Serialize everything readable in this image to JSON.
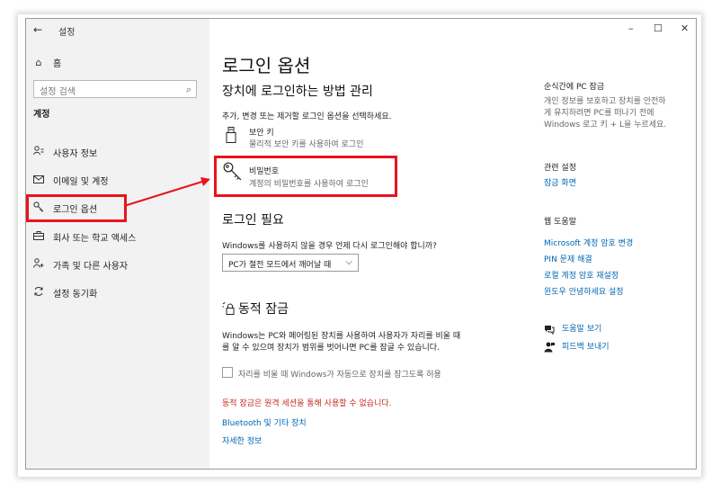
{
  "window": {
    "back_icon": "back-arrow-icon",
    "title": "설정",
    "minimize": "–",
    "maximize": "☐",
    "close": "✕"
  },
  "sidebar": {
    "home_label": "홈",
    "search_placeholder": "설정 검색",
    "section_title": "계정",
    "items": [
      {
        "label": "사용자 정보",
        "icon": "person-icon"
      },
      {
        "label": "이메일 및 계정",
        "icon": "mail-icon"
      },
      {
        "label": "로그인 옵션",
        "icon": "key-icon"
      },
      {
        "label": "회사 또는 학교 액세스",
        "icon": "briefcase-icon"
      },
      {
        "label": "가족 및 다른 사용자",
        "icon": "people-icon"
      },
      {
        "label": "설정 동기화",
        "icon": "sync-icon"
      }
    ]
  },
  "main": {
    "page_title": "로그인 옵션",
    "manage_title": "장치에 로그인하는 방법 관리",
    "manage_desc": "추가, 변경 또는 제거할 로그인 옵션을 선택하세요.",
    "options": [
      {
        "title": "보안 키",
        "desc": "물리적 보안 키를 사용하여 로그인"
      },
      {
        "title": "비밀번호",
        "desc": "계정의 비밀번호를 사용하여 로그인"
      }
    ],
    "require_title": "로그인 필요",
    "require_question": "Windows를 사용하지 않을 경우 언제 다시 로그인해야 합니까?",
    "require_value": "PC가 절전 모드에서 깨어날 때",
    "dynamic_title": "동적 잠금",
    "dynamic_desc_1": "Windows는 PC와 페어링된 장치를 사용하여 사용자가 자리를 비울 때",
    "dynamic_desc_2": "를 알 수 있으며 장치가 범위를 벗어나면 PC를 잠글 수 있습니다.",
    "dynamic_checkbox": "자리를 비울 때 Windows가 자동으로 장치를 잠그도록 허용",
    "dynamic_error": "동적 잠금은 원격 세션을 통해 사용할 수 없습니다.",
    "links": [
      "Bluetooth 및 기타 장치",
      "자세한 정보"
    ]
  },
  "right": {
    "lock_title": "순식간에 PC 잠금",
    "lock_desc_1": "개인 정보를 보호하고 장치를 안전하",
    "lock_desc_2": "게 유지하려면 PC를 떠나기 전에",
    "lock_desc_3": "Windows 로고 키 + L을 누르세요.",
    "related_title": "관련 설정",
    "related_link": "잠금 화면",
    "help_title": "웹 도움말",
    "help_links": [
      "Microsoft 계정 암호 변경",
      "PIN 문제 해결",
      "로컬 계정 암호 재설정",
      "윈도우 안녕하세요 설정"
    ],
    "get_help": "도움말 보기",
    "feedback": "피드백 보내기"
  },
  "colors": {
    "accent": "#0066b4",
    "highlight": "#e8141b",
    "error": "#c42b1c",
    "sidebar_bg": "#f2f2f2"
  }
}
